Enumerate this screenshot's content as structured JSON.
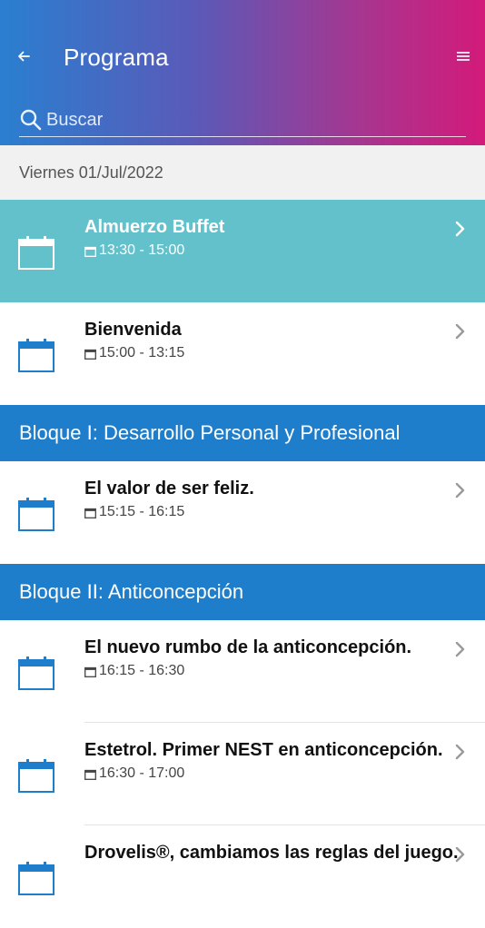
{
  "header": {
    "title": "Programa",
    "search_placeholder": "Buscar"
  },
  "date_label": "Viernes 01/Jul/2022",
  "colors": {
    "accent_blue": "#1f7ecb",
    "active_teal": "#63c1cc",
    "gradient_start": "#2a7fd0",
    "gradient_end": "#d31a7a"
  },
  "rows": [
    {
      "kind": "item",
      "name": "Almuerzo Buffet",
      "time": "13:30 - 15:00",
      "active": true
    },
    {
      "kind": "item",
      "name": "Bienvenida",
      "time": "15:00 - 13:15"
    },
    {
      "kind": "section",
      "label": "Bloque I: Desarrollo Personal y Profesional"
    },
    {
      "kind": "item",
      "name": "El valor de ser feliz.",
      "time": "15:15 - 16:15"
    },
    {
      "kind": "section",
      "label": "Bloque II: Anticoncepción"
    },
    {
      "kind": "item",
      "name": "El nuevo rumbo de la anticoncepción.",
      "time": "16:15 - 16:30",
      "divider": true
    },
    {
      "kind": "item",
      "name": "Estetrol. Primer NEST en anticoncepción.",
      "time": "16:30 - 17:00",
      "divider": true
    },
    {
      "kind": "item",
      "name": "Drovelis®, cambiamos las reglas del juego.",
      "time": ""
    }
  ]
}
